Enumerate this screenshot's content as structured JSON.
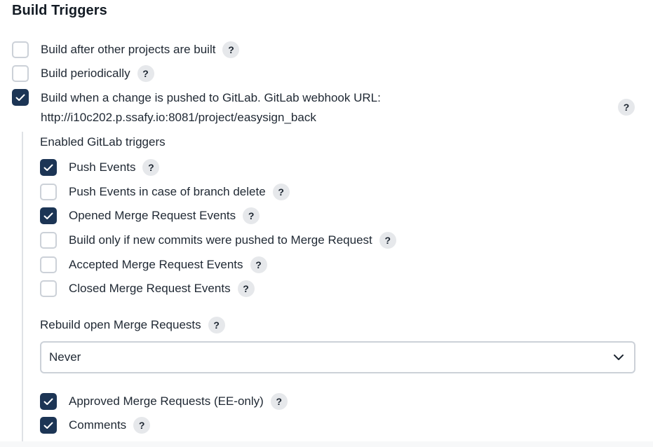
{
  "section": {
    "title": "Build Triggers"
  },
  "triggers": [
    {
      "label": "Build after other projects are built",
      "checked": false
    },
    {
      "label": "Build periodically",
      "checked": false
    }
  ],
  "gitlab": {
    "checked": true,
    "label_line1": "Build when a change is pushed to GitLab. GitLab webhook URL:",
    "label_line2": "http://i10c202.p.ssafy.io:8081/project/easysign_back"
  },
  "enabled_triggers": {
    "heading": "Enabled GitLab triggers",
    "items": [
      {
        "label": "Push Events",
        "checked": true
      },
      {
        "label": "Push Events in case of branch delete",
        "checked": false
      },
      {
        "label": "Opened Merge Request Events",
        "checked": true
      },
      {
        "label": "Build only if new commits were pushed to Merge Request",
        "checked": false
      },
      {
        "label": "Accepted Merge Request Events",
        "checked": false
      },
      {
        "label": "Closed Merge Request Events",
        "checked": false
      }
    ]
  },
  "rebuild": {
    "label": "Rebuild open Merge Requests",
    "selected": "Never"
  },
  "extra_options": [
    {
      "label": "Approved Merge Requests (EE-only)",
      "checked": true
    },
    {
      "label": "Comments",
      "checked": true
    }
  ],
  "help_symbol": "?",
  "colors": {
    "checkbox_checked": "#1c3555",
    "checkbox_border": "#ccd1d8",
    "help_bg": "#e6e8eb"
  },
  "icons": {
    "checked_mark": "checkmark-icon",
    "select_arrow": "chevron-down-icon"
  }
}
